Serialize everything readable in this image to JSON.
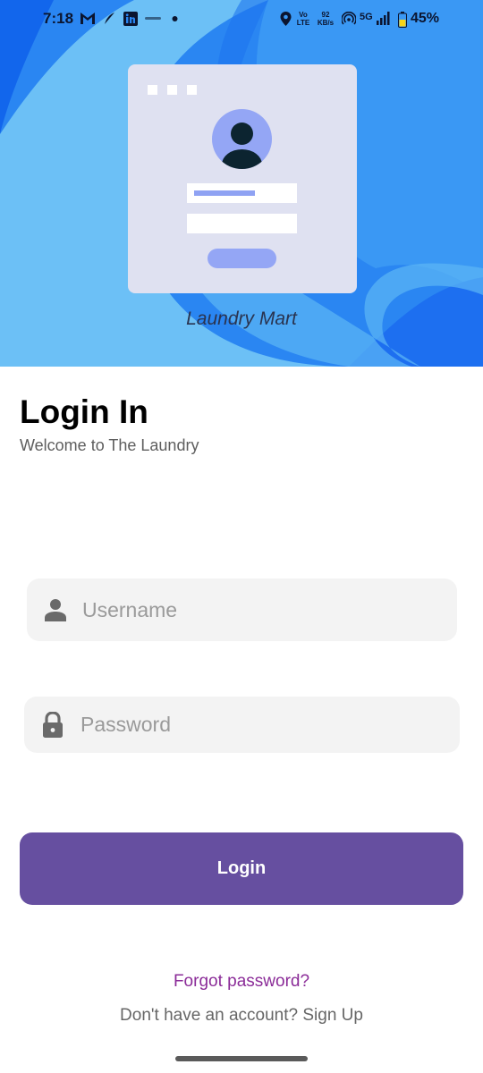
{
  "status_bar": {
    "time": "7:18",
    "volte": "Vo\nLTE",
    "speed": "92\nKB/s",
    "network": "5G",
    "battery": "45%",
    "icons": [
      "gmail-icon",
      "feather-icon",
      "linkedin-icon",
      "media-icon",
      "dot-icon",
      "location-icon",
      "hotspot-icon",
      "signal-icon",
      "battery-icon"
    ]
  },
  "hero": {
    "brand": "Laundry Mart",
    "colors": {
      "deep_blue": "#1f6ef0",
      "light_blue": "#63bdf5",
      "card": "#dfe1f1",
      "avatar": "#94a6f5"
    }
  },
  "login": {
    "title": "Login In",
    "subtitle": "Welcome to The Laundry",
    "username_placeholder": "Username",
    "password_placeholder": "Password",
    "button_label": "Login",
    "forgot_label": "Forgot password?",
    "signup_prompt": "Don't have an account?",
    "signup_link": "Sign Up"
  },
  "colors": {
    "accent": "#664fa0",
    "link": "#8b2c98",
    "input_bg": "#f3f3f3"
  }
}
